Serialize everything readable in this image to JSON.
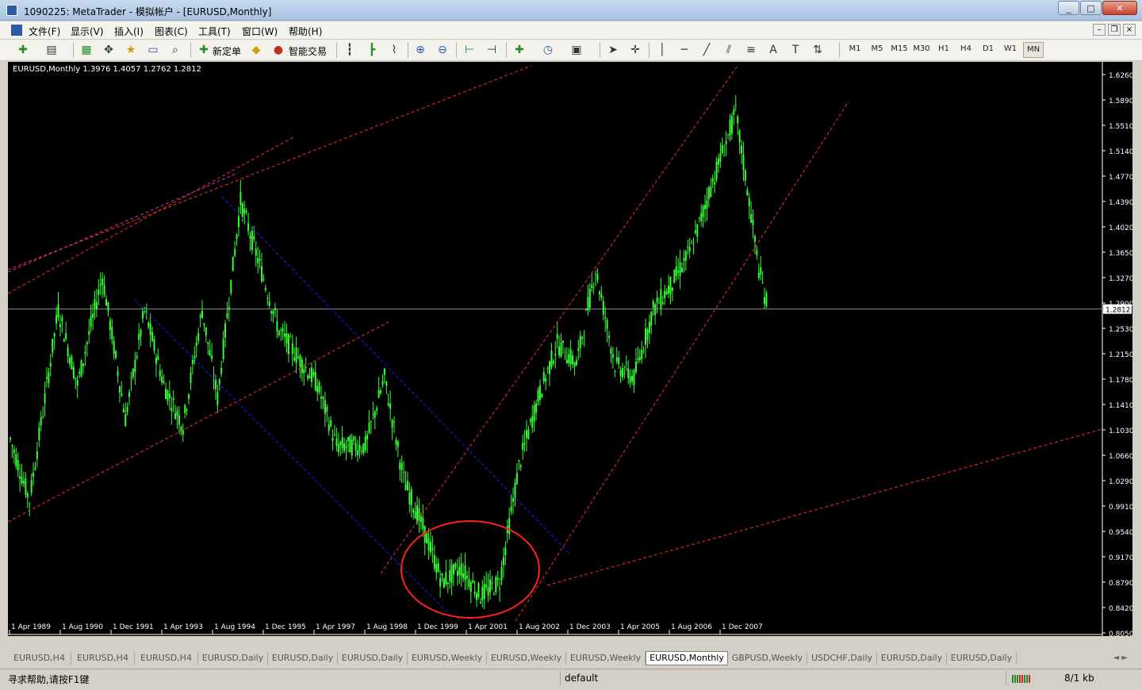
{
  "window": {
    "title": "1090225: MetaTrader - 模拟帐户 - [EURUSD,Monthly]",
    "minimize": "_",
    "maximize": "□",
    "close": "✕"
  },
  "menu": [
    {
      "id": "file",
      "label": "文件(F)"
    },
    {
      "id": "view",
      "label": "显示(V)"
    },
    {
      "id": "insert",
      "label": "插入(I)"
    },
    {
      "id": "charts",
      "label": "图表(C)"
    },
    {
      "id": "tools",
      "label": "工具(T)"
    },
    {
      "id": "window",
      "label": "窗口(W)"
    },
    {
      "id": "help",
      "label": "帮助(H)"
    }
  ],
  "mdi": {
    "minimize": "–",
    "restore": "❐",
    "close": "×"
  },
  "toolbar": {
    "new_order": "新定单",
    "expert": "智能交易",
    "line_tools": {
      "text": "A",
      "text_label": "T"
    },
    "timeframes": [
      "M1",
      "M5",
      "M15",
      "M30",
      "H1",
      "H4",
      "D1",
      "W1",
      "MN"
    ],
    "active_timeframe": "MN"
  },
  "chart": {
    "info": "EURUSD,Monthly  1.3976 1.4057 1.2762 1.2812",
    "current_price": "1.2812",
    "price_axis": [
      "1.6260",
      "1.5890",
      "1.5510",
      "1.5140",
      "1.4770",
      "1.4390",
      "1.4020",
      "1.3650",
      "1.3270",
      "1.2900",
      "1.2530",
      "1.2150",
      "1.1780",
      "1.1410",
      "1.1030",
      "1.0660",
      "1.0290",
      "0.9910",
      "0.9540",
      "0.9170",
      "0.8790",
      "0.8420",
      "0.8050"
    ],
    "time_axis": [
      "1 Apr 1989",
      "1 Aug 1990",
      "1 Dec 1991",
      "1 Apr 1993",
      "1 Aug 1994",
      "1 Dec 1995",
      "1 Apr 1997",
      "1 Aug 1998",
      "1 Dec 1999",
      "1 Apr 2001",
      "1 Aug 2002",
      "1 Dec 2003",
      "1 Apr 2005",
      "1 Aug 2006",
      "1 Dec 2007"
    ],
    "colors": {
      "background": "#000000",
      "candles": "#33ff33",
      "axis": "#ffffff",
      "red_lines": "#ff2a2a",
      "blue_lines": "#1a1aff",
      "circle": "#ff2020"
    }
  },
  "tabs": [
    "EURUSD,H4",
    "EURUSD,H4",
    "EURUSD,H4",
    "EURUSD,Daily",
    "EURUSD,Daily",
    "EURUSD,Daily",
    "EURUSD,Weekly",
    "EURUSD,Weekly",
    "EURUSD,Weekly",
    "EURUSD,Monthly",
    "GBPUSD,Weekly",
    "USDCHF,Daily",
    "EURUSD,Daily",
    "EURUSD,Daily"
  ],
  "active_tab": "EURUSD,Monthly",
  "tab_nav": "◄ ►",
  "status": {
    "help": "寻求帮助,请按F1键",
    "profile": "default",
    "traffic": "8/1 kb"
  }
}
